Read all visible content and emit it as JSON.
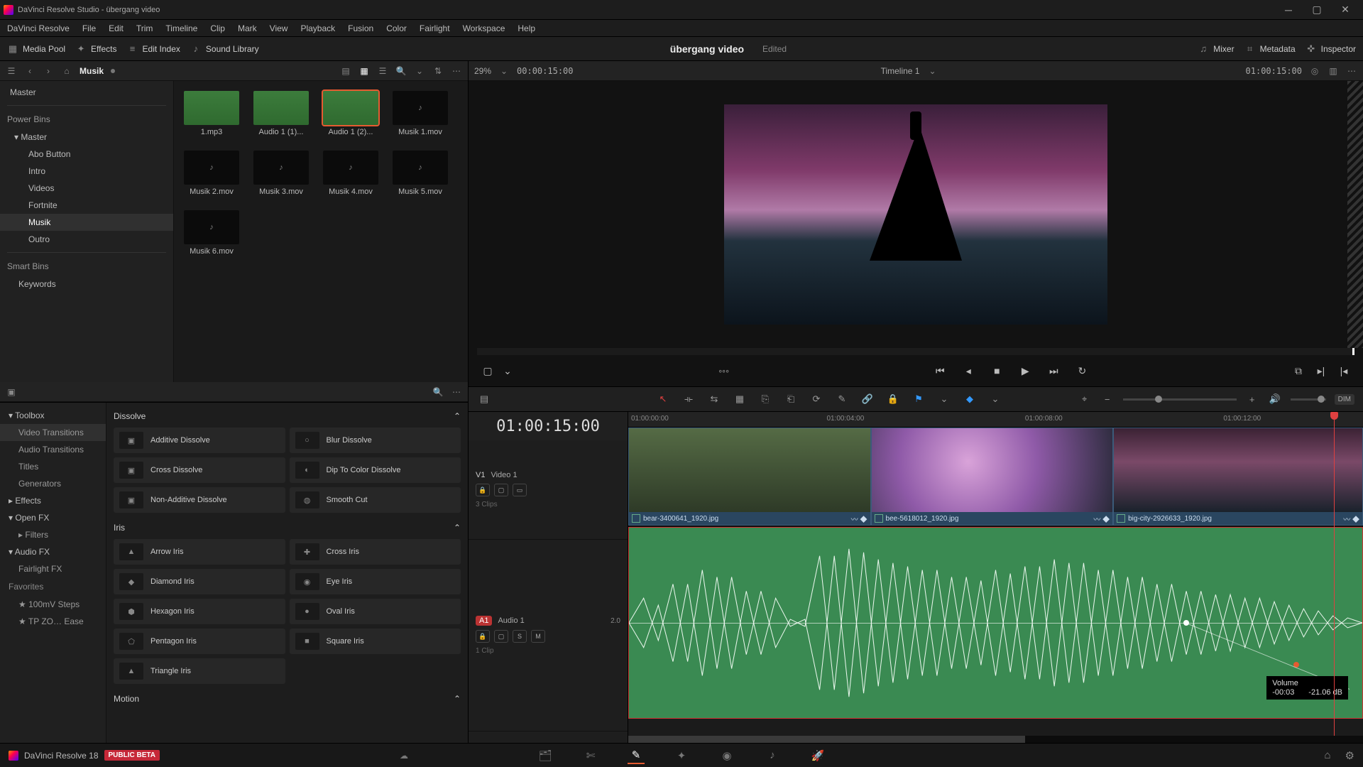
{
  "title": "DaVinci Resolve Studio - übergang video",
  "menu": [
    "DaVinci Resolve",
    "File",
    "Edit",
    "Trim",
    "Timeline",
    "Clip",
    "Mark",
    "View",
    "Playback",
    "Fusion",
    "Color",
    "Fairlight",
    "Workspace",
    "Help"
  ],
  "tb": {
    "mediaPool": "Media Pool",
    "effects": "Effects",
    "editIndex": "Edit Index",
    "soundLib": "Sound Library",
    "project": "übergang video",
    "state": "Edited",
    "mixer": "Mixer",
    "metadata": "Metadata",
    "inspector": "Inspector"
  },
  "mp": {
    "bin": "Musik",
    "zoom": "29%",
    "src_tc": "00:00:15:00",
    "timeline": "Timeline 1",
    "rec_tc": "01:00:15:00",
    "tree": {
      "master": "Master",
      "power": "Power Bins",
      "p_master": "Master",
      "items": [
        "Abo Button",
        "Intro",
        "Videos",
        "Fortnite",
        "Musik",
        "Outro"
      ],
      "smart": "Smart Bins",
      "kw": "Keywords"
    },
    "clips": [
      {
        "l": "1.mp3",
        "w": 1
      },
      {
        "l": "Audio 1 (1)...",
        "w": 1
      },
      {
        "l": "Audio 1 (2)...",
        "w": 1,
        "s": 1
      },
      {
        "l": "Musik 1.mov"
      },
      {
        "l": "Musik 2.mov"
      },
      {
        "l": "Musik 3.mov"
      },
      {
        "l": "Musik 4.mov"
      },
      {
        "l": "Musik 5.mov"
      },
      {
        "l": "Musik 6.mov"
      }
    ]
  },
  "fx": {
    "side": [
      "Toolbox",
      "Video Transitions",
      "Audio Transitions",
      "Titles",
      "Generators",
      "Effects",
      "Open FX",
      "Filters",
      "Audio FX",
      "Fairlight FX"
    ],
    "fav": "Favorites",
    "favs": [
      "100mV Steps",
      "TP ZO… Ease"
    ],
    "g1": {
      "t": "Dissolve",
      "items": [
        "Additive Dissolve",
        "Blur Dissolve",
        "Cross Dissolve",
        "Dip To Color Dissolve",
        "Non-Additive Dissolve",
        "Smooth Cut"
      ]
    },
    "g2": {
      "t": "Iris",
      "items": [
        "Arrow Iris",
        "Cross Iris",
        "Diamond Iris",
        "Eye Iris",
        "Hexagon Iris",
        "Oval Iris",
        "Pentagon Iris",
        "Square Iris",
        "Triangle Iris"
      ]
    },
    "g3": {
      "t": "Motion"
    }
  },
  "tl": {
    "tc": "01:00:15:00",
    "v1": "V1",
    "v1n": "Video 1",
    "v1c": "3 Clips",
    "a1": "A1",
    "a1n": "Audio 1",
    "a1g": "2.0",
    "a1c": "1 Clip",
    "ruler": [
      "01:00:00:00",
      "01:00:04:00",
      "01:00:08:00",
      "01:00:12:00"
    ],
    "clips": [
      "bear-3400641_1920.jpg",
      "bee-5618012_1920.jpg",
      "big-city-2926633_1920.jpg"
    ],
    "vol": {
      "label": "Volume",
      "dt": "-00:03",
      "db": "-21.06 dB"
    },
    "btns": {
      "s": "S",
      "m": "M"
    }
  },
  "nav": {
    "app": "DaVinci Resolve 18",
    "beta": "PUBLIC BETA"
  }
}
